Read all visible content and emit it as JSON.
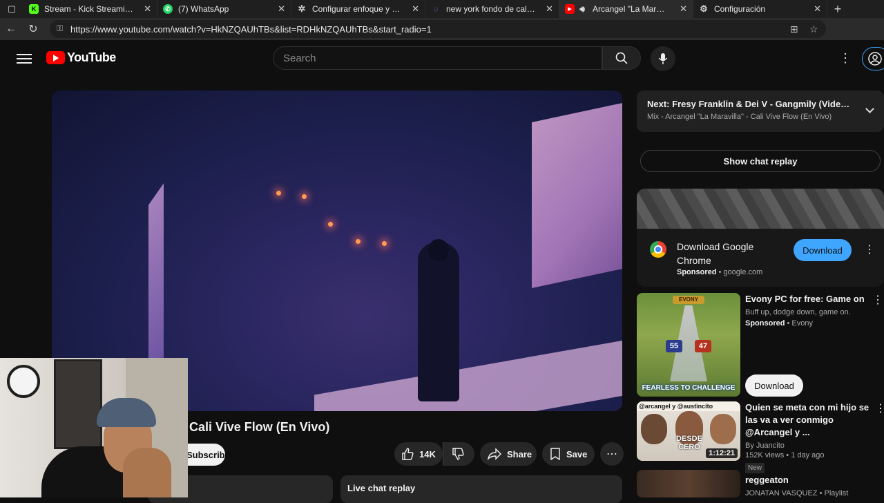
{
  "browser": {
    "tabs": [
      {
        "title": "Stream - Kick Streaming",
        "fav": "K",
        "fav_color": "#53fc18",
        "active": false
      },
      {
        "title": "(7) WhatsApp",
        "fav": "W",
        "fav_color": "#25d366",
        "active": false
      },
      {
        "title": "Configurar enfoque y filtros",
        "fav": "⚙",
        "fav_color": "#cfcfcf",
        "active": false
      },
      {
        "title": "new york fondo de calle noc",
        "fav": "◦",
        "fav_color": "#6b8cff",
        "active": false
      },
      {
        "title": "Arcangel \"La Maravilla\"",
        "fav": "▶",
        "fav_color": "#ff0000",
        "active": true
      },
      {
        "title": "Configuración",
        "fav": "⚙",
        "fav_color": "#cfcfcf",
        "active": false
      }
    ],
    "url": "https://www.youtube.com/watch?v=HkNZQAUhTBs&list=RDHkNZQAUhTBs&start_radio=1"
  },
  "youtube": {
    "logo_text": "YouTube",
    "search_placeholder": "Search",
    "video_title": "Cali Vive Flow (En Vivo)",
    "subscribe_label": "Subscribe",
    "likes": "14K",
    "share_label": "Share",
    "save_label": "Save",
    "live_chat_replay": "Live chat replay"
  },
  "playlist": {
    "next_prefix": "Next:",
    "next_title": "Fresy Franklin & Dei V - Gangmily (Video Oficial)",
    "mix": "Mix - Arcangel \"La Maravilla\" - Cali Vive Flow (En Vivo)"
  },
  "show_chat_replay": "Show chat replay",
  "ad": {
    "title": "Download Google Chrome",
    "sponsored": "Sponsored",
    "domain": "google.com",
    "button": "Download"
  },
  "recommendations": [
    {
      "title": "Evony PC for free: Game on",
      "line1": "Buff up, dodge down, game on.",
      "sponsored": "Sponsored",
      "channel": "Evony",
      "button": "Download"
    },
    {
      "title": "Quien se meta con mi hijo se las va a ver conmigo @Arcangel y ...",
      "channel": "By Juancito",
      "stats": "152K views • 1 day ago",
      "badge": "New",
      "duration": "1:12:21",
      "thumb_top_text": "@arcangel y @austincito",
      "thumb_text": "DESDE CERO"
    },
    {
      "title": "reggeaton",
      "channel": "JONATAN VASQUEZ",
      "type": "Playlist"
    }
  ],
  "evony_thumb": {
    "brand": "EVONY",
    "caption": "FEARLESS TO CHALLENGE",
    "n1": "55",
    "n2": "47"
  }
}
